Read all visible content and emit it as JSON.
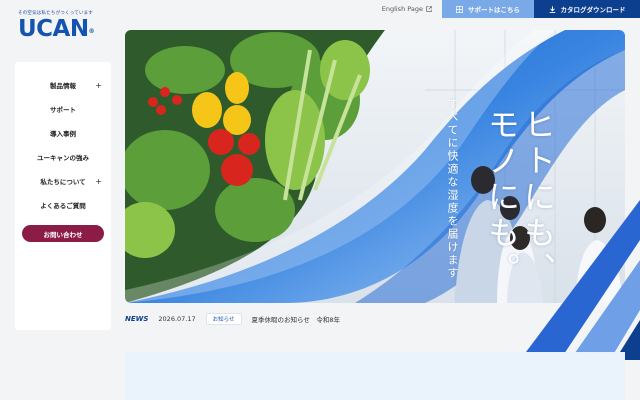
{
  "header": {
    "tagline": "その空気は私たちがつくっています",
    "brand": "UCAN",
    "brand_mark": "®",
    "english_page": "English Page",
    "support_button": "サポートはこちら",
    "catalog_button": "カタログダウンロード"
  },
  "sidebar": {
    "items": [
      {
        "label": "製品情報",
        "expandable": true
      },
      {
        "label": "サポート",
        "expandable": false
      },
      {
        "label": "導入事例",
        "expandable": false
      },
      {
        "label": "ユーキャンの強み",
        "expandable": false
      },
      {
        "label": "私たちについて",
        "expandable": true
      },
      {
        "label": "よくあるご質問",
        "expandable": false
      }
    ],
    "contact_button": "お問い合わせ"
  },
  "hero": {
    "copy_small": "すべてに快適な湿度を届けます",
    "copy_line1": "ヒトにも、",
    "copy_line2": "モノにも。"
  },
  "news": {
    "label": "NEWS",
    "date": "2026.07.17",
    "category": "お知らせ",
    "title": "夏季休暇のお知らせ　令和8年"
  },
  "icons": {
    "english_page": "external-link-icon",
    "support": "grid-icon",
    "catalog": "download-icon",
    "expand": "plus-icon"
  },
  "colors": {
    "brand_blue": "#1454b0",
    "navy": "#0d3f8f",
    "light_blue": "#7aa9e8",
    "contact": "#8a1c45"
  }
}
